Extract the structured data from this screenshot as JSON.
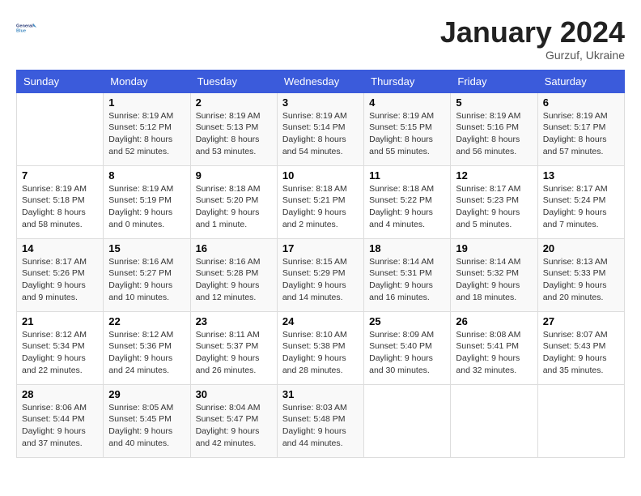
{
  "header": {
    "logo_line1": "General",
    "logo_line2": "Blue",
    "title": "January 2024",
    "subtitle": "Gurzuf, Ukraine"
  },
  "weekdays": [
    "Sunday",
    "Monday",
    "Tuesday",
    "Wednesday",
    "Thursday",
    "Friday",
    "Saturday"
  ],
  "weeks": [
    [
      {
        "day": "",
        "sunrise": "",
        "sunset": "",
        "daylight": ""
      },
      {
        "day": "1",
        "sunrise": "Sunrise: 8:19 AM",
        "sunset": "Sunset: 5:12 PM",
        "daylight": "Daylight: 8 hours and 52 minutes."
      },
      {
        "day": "2",
        "sunrise": "Sunrise: 8:19 AM",
        "sunset": "Sunset: 5:13 PM",
        "daylight": "Daylight: 8 hours and 53 minutes."
      },
      {
        "day": "3",
        "sunrise": "Sunrise: 8:19 AM",
        "sunset": "Sunset: 5:14 PM",
        "daylight": "Daylight: 8 hours and 54 minutes."
      },
      {
        "day": "4",
        "sunrise": "Sunrise: 8:19 AM",
        "sunset": "Sunset: 5:15 PM",
        "daylight": "Daylight: 8 hours and 55 minutes."
      },
      {
        "day": "5",
        "sunrise": "Sunrise: 8:19 AM",
        "sunset": "Sunset: 5:16 PM",
        "daylight": "Daylight: 8 hours and 56 minutes."
      },
      {
        "day": "6",
        "sunrise": "Sunrise: 8:19 AM",
        "sunset": "Sunset: 5:17 PM",
        "daylight": "Daylight: 8 hours and 57 minutes."
      }
    ],
    [
      {
        "day": "7",
        "sunrise": "Sunrise: 8:19 AM",
        "sunset": "Sunset: 5:18 PM",
        "daylight": "Daylight: 8 hours and 58 minutes."
      },
      {
        "day": "8",
        "sunrise": "Sunrise: 8:19 AM",
        "sunset": "Sunset: 5:19 PM",
        "daylight": "Daylight: 9 hours and 0 minutes."
      },
      {
        "day": "9",
        "sunrise": "Sunrise: 8:18 AM",
        "sunset": "Sunset: 5:20 PM",
        "daylight": "Daylight: 9 hours and 1 minute."
      },
      {
        "day": "10",
        "sunrise": "Sunrise: 8:18 AM",
        "sunset": "Sunset: 5:21 PM",
        "daylight": "Daylight: 9 hours and 2 minutes."
      },
      {
        "day": "11",
        "sunrise": "Sunrise: 8:18 AM",
        "sunset": "Sunset: 5:22 PM",
        "daylight": "Daylight: 9 hours and 4 minutes."
      },
      {
        "day": "12",
        "sunrise": "Sunrise: 8:17 AM",
        "sunset": "Sunset: 5:23 PM",
        "daylight": "Daylight: 9 hours and 5 minutes."
      },
      {
        "day": "13",
        "sunrise": "Sunrise: 8:17 AM",
        "sunset": "Sunset: 5:24 PM",
        "daylight": "Daylight: 9 hours and 7 minutes."
      }
    ],
    [
      {
        "day": "14",
        "sunrise": "Sunrise: 8:17 AM",
        "sunset": "Sunset: 5:26 PM",
        "daylight": "Daylight: 9 hours and 9 minutes."
      },
      {
        "day": "15",
        "sunrise": "Sunrise: 8:16 AM",
        "sunset": "Sunset: 5:27 PM",
        "daylight": "Daylight: 9 hours and 10 minutes."
      },
      {
        "day": "16",
        "sunrise": "Sunrise: 8:16 AM",
        "sunset": "Sunset: 5:28 PM",
        "daylight": "Daylight: 9 hours and 12 minutes."
      },
      {
        "day": "17",
        "sunrise": "Sunrise: 8:15 AM",
        "sunset": "Sunset: 5:29 PM",
        "daylight": "Daylight: 9 hours and 14 minutes."
      },
      {
        "day": "18",
        "sunrise": "Sunrise: 8:14 AM",
        "sunset": "Sunset: 5:31 PM",
        "daylight": "Daylight: 9 hours and 16 minutes."
      },
      {
        "day": "19",
        "sunrise": "Sunrise: 8:14 AM",
        "sunset": "Sunset: 5:32 PM",
        "daylight": "Daylight: 9 hours and 18 minutes."
      },
      {
        "day": "20",
        "sunrise": "Sunrise: 8:13 AM",
        "sunset": "Sunset: 5:33 PM",
        "daylight": "Daylight: 9 hours and 20 minutes."
      }
    ],
    [
      {
        "day": "21",
        "sunrise": "Sunrise: 8:12 AM",
        "sunset": "Sunset: 5:34 PM",
        "daylight": "Daylight: 9 hours and 22 minutes."
      },
      {
        "day": "22",
        "sunrise": "Sunrise: 8:12 AM",
        "sunset": "Sunset: 5:36 PM",
        "daylight": "Daylight: 9 hours and 24 minutes."
      },
      {
        "day": "23",
        "sunrise": "Sunrise: 8:11 AM",
        "sunset": "Sunset: 5:37 PM",
        "daylight": "Daylight: 9 hours and 26 minutes."
      },
      {
        "day": "24",
        "sunrise": "Sunrise: 8:10 AM",
        "sunset": "Sunset: 5:38 PM",
        "daylight": "Daylight: 9 hours and 28 minutes."
      },
      {
        "day": "25",
        "sunrise": "Sunrise: 8:09 AM",
        "sunset": "Sunset: 5:40 PM",
        "daylight": "Daylight: 9 hours and 30 minutes."
      },
      {
        "day": "26",
        "sunrise": "Sunrise: 8:08 AM",
        "sunset": "Sunset: 5:41 PM",
        "daylight": "Daylight: 9 hours and 32 minutes."
      },
      {
        "day": "27",
        "sunrise": "Sunrise: 8:07 AM",
        "sunset": "Sunset: 5:43 PM",
        "daylight": "Daylight: 9 hours and 35 minutes."
      }
    ],
    [
      {
        "day": "28",
        "sunrise": "Sunrise: 8:06 AM",
        "sunset": "Sunset: 5:44 PM",
        "daylight": "Daylight: 9 hours and 37 minutes."
      },
      {
        "day": "29",
        "sunrise": "Sunrise: 8:05 AM",
        "sunset": "Sunset: 5:45 PM",
        "daylight": "Daylight: 9 hours and 40 minutes."
      },
      {
        "day": "30",
        "sunrise": "Sunrise: 8:04 AM",
        "sunset": "Sunset: 5:47 PM",
        "daylight": "Daylight: 9 hours and 42 minutes."
      },
      {
        "day": "31",
        "sunrise": "Sunrise: 8:03 AM",
        "sunset": "Sunset: 5:48 PM",
        "daylight": "Daylight: 9 hours and 44 minutes."
      },
      {
        "day": "",
        "sunrise": "",
        "sunset": "",
        "daylight": ""
      },
      {
        "day": "",
        "sunrise": "",
        "sunset": "",
        "daylight": ""
      },
      {
        "day": "",
        "sunrise": "",
        "sunset": "",
        "daylight": ""
      }
    ]
  ]
}
